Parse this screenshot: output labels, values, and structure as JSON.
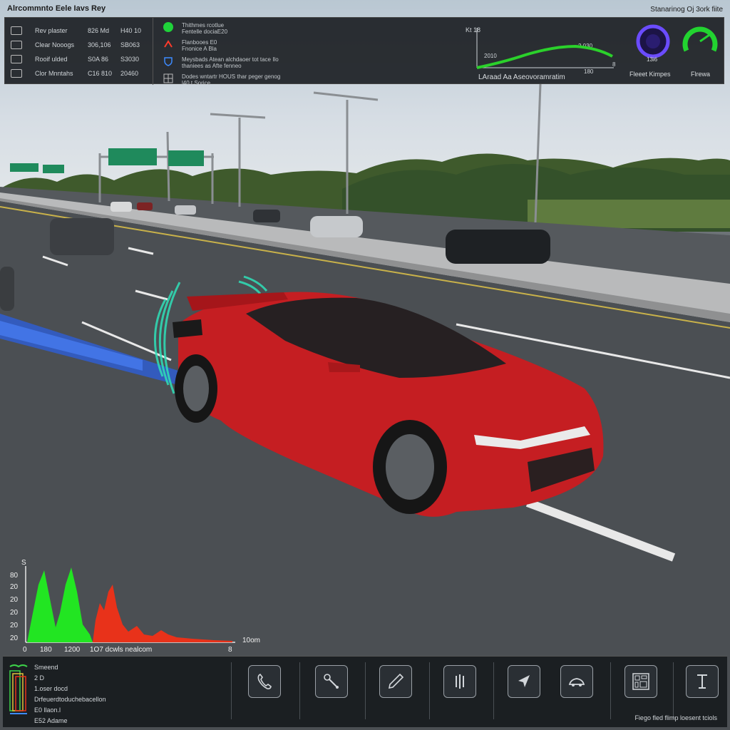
{
  "app": {
    "title": "Alrcommnto Eele Iavs Rey",
    "right_title": "Stanarinog Oj 3ork fiite"
  },
  "readouts": [
    {
      "icon": "gauge-icon",
      "label": "Rev plaster",
      "value1": "826 Md",
      "value2": "H40 10"
    },
    {
      "icon": "car-icon",
      "label": "Clear Nooogs",
      "value1": "306,106",
      "value2": "SB063"
    },
    {
      "icon": "car-icon",
      "label": "Rooif ulded",
      "value1": "S0A 86",
      "value2": "S3030"
    },
    {
      "icon": "monitor-icon",
      "label": "Clor Mnntahs",
      "value1": "C16 810",
      "value2": "20460"
    }
  ],
  "statuses": [
    {
      "icon": "green-dot-icon",
      "lines": [
        "Thithmes rcotlue",
        "Fentelle dociaE20"
      ]
    },
    {
      "icon": "warning-chevron-icon",
      "lines": [
        "Flanbooes E0",
        "Fnonice A Bla"
      ]
    },
    {
      "icon": "shield-icon",
      "lines": [
        "Meysbads Atean alchdaoer tot tace Ilo",
        "thaniees as Afte fenneo"
      ]
    },
    {
      "icon": "grid-icon",
      "lines": [
        "Dodes wntartr HOUS thar peger genog",
        "l40 t Sorice"
      ]
    }
  ],
  "line_chart": {
    "caption": "LAraad Aa Aseovoramratim",
    "y_top_label": "Kt 18",
    "label_a": "2010",
    "label_b": "2,030",
    "label_c": "180",
    "x_end_label": "8",
    "series_color": "#2bd12b"
  },
  "gauges": [
    {
      "label": "Fleeet Kimpes",
      "value": "13i6",
      "color": "#6b4cff"
    },
    {
      "label": "Flrewa",
      "value": "",
      "color": "#22d330"
    }
  ],
  "spectrum": {
    "y_top": "S",
    "y_ticks": [
      "80",
      "20",
      "20",
      "20",
      "20",
      "20"
    ],
    "x_ticks": [
      "0",
      "180",
      "1200",
      "8"
    ],
    "x_caption": "1O7 dcwls nealcom",
    "x_end_label": "10om",
    "green_color": "#22e522",
    "red_color": "#e8321a"
  },
  "legend": [
    "Smeend",
    "2 D",
    "1.oser docd",
    "Drfeuerdtoduchebacellon",
    "E0 llaon.l",
    "E52 Adame"
  ],
  "tools": [
    {
      "name": "tool-phone",
      "icon": "phone-icon"
    },
    {
      "name": "tool-wrench",
      "icon": "wrench-icon"
    },
    {
      "name": "tool-pen",
      "icon": "pen-icon"
    },
    {
      "name": "tool-bars",
      "icon": "bars-icon"
    },
    {
      "name": "tool-navigate",
      "icon": "navigate-icon"
    },
    {
      "name": "tool-car",
      "icon": "car-icon"
    },
    {
      "name": "tool-layout",
      "icon": "layout-icon"
    },
    {
      "name": "tool-measure",
      "icon": "measure-icon"
    }
  ],
  "bottom_caption": "Fiego fled flimp loesent tciols"
}
